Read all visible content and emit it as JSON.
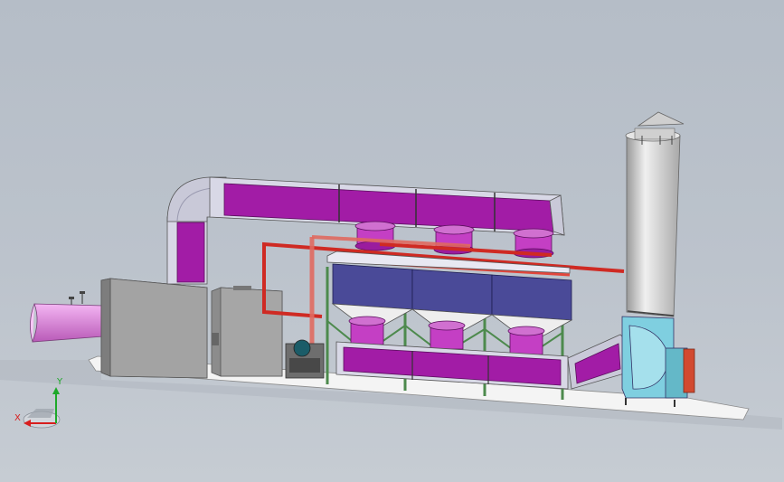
{
  "axis_triad": {
    "x_label": "X",
    "y_label": "Y",
    "x_color": "#d81e1e",
    "y_color": "#1ea82a"
  },
  "colors": {
    "background": "#bcc3cc",
    "duct_magenta": "#a21ca6",
    "duct_light": "#d8d8e6",
    "adsorber_blue": "#4a4a98",
    "frame_green": "#4d8a4d",
    "pipe_red": "#cf2a23",
    "cabinet_gray": "#9d9d9d",
    "stack_gray": "#d6d6d6",
    "fan_cyan": "#7fcfe0",
    "inlet_pink": "#e98fe8",
    "base_white": "#f4f4f4"
  }
}
